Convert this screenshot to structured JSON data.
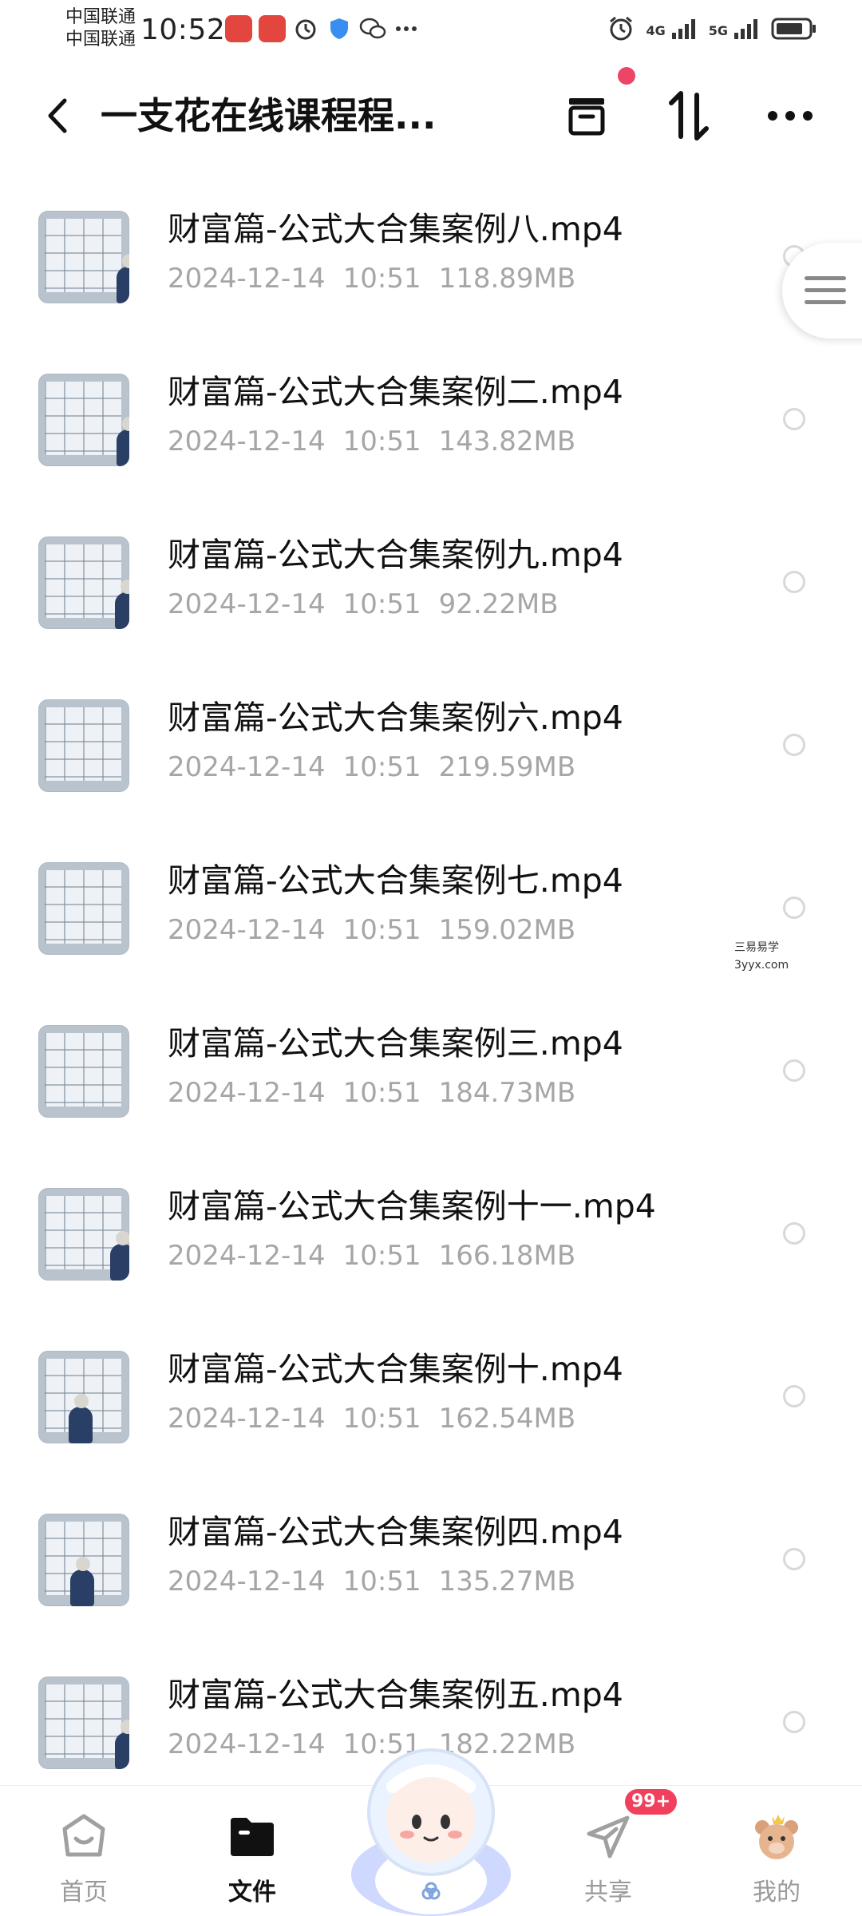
{
  "status_bar": {
    "carrier_1": "中国联通",
    "carrier_2": "中国联通",
    "time": "10:52",
    "signal_1": "4G",
    "signal_2": "5G"
  },
  "header": {
    "title": "一支花在线课程程...",
    "icons": [
      "back-icon",
      "archive-box-icon",
      "sort-icon",
      "more-icon"
    ]
  },
  "files": [
    {
      "name": "财富篇-公式大合集案例八.mp4",
      "date": "2024-12-14",
      "time": "10:51",
      "size": "118.89MB"
    },
    {
      "name": "财富篇-公式大合集案例二.mp4",
      "date": "2024-12-14",
      "time": "10:51",
      "size": "143.82MB"
    },
    {
      "name": "财富篇-公式大合集案例九.mp4",
      "date": "2024-12-14",
      "time": "10:51",
      "size": "92.22MB"
    },
    {
      "name": "财富篇-公式大合集案例六.mp4",
      "date": "2024-12-14",
      "time": "10:51",
      "size": "219.59MB"
    },
    {
      "name": "财富篇-公式大合集案例七.mp4",
      "date": "2024-12-14",
      "time": "10:51",
      "size": "159.02MB"
    },
    {
      "name": "财富篇-公式大合集案例三.mp4",
      "date": "2024-12-14",
      "time": "10:51",
      "size": "184.73MB"
    },
    {
      "name": "财富篇-公式大合集案例十一.mp4",
      "date": "2024-12-14",
      "time": "10:51",
      "size": "166.18MB"
    },
    {
      "name": "财富篇-公式大合集案例十.mp4",
      "date": "2024-12-14",
      "time": "10:51",
      "size": "162.54MB"
    },
    {
      "name": "财富篇-公式大合集案例四.mp4",
      "date": "2024-12-14",
      "time": "10:51",
      "size": "135.27MB"
    },
    {
      "name": "财富篇-公式大合集案例五.mp4",
      "date": "2024-12-14",
      "time": "10:51",
      "size": "182.22MB"
    }
  ],
  "watermark": {
    "line1": "三易易学",
    "line2": "3yyx.com"
  },
  "bottom_nav": {
    "items": [
      {
        "label": "首页",
        "icon": "home-icon"
      },
      {
        "label": "文件",
        "icon": "folder-icon",
        "active": true
      },
      {
        "label": "共享",
        "icon": "paper-plane-icon"
      },
      {
        "label": "我的",
        "icon": "bear-avatar-icon"
      }
    ],
    "share_badge": "99+"
  },
  "colors": {
    "accent_red": "#f0405e",
    "meta_gray": "#a6a6a6",
    "text": "#111111"
  }
}
